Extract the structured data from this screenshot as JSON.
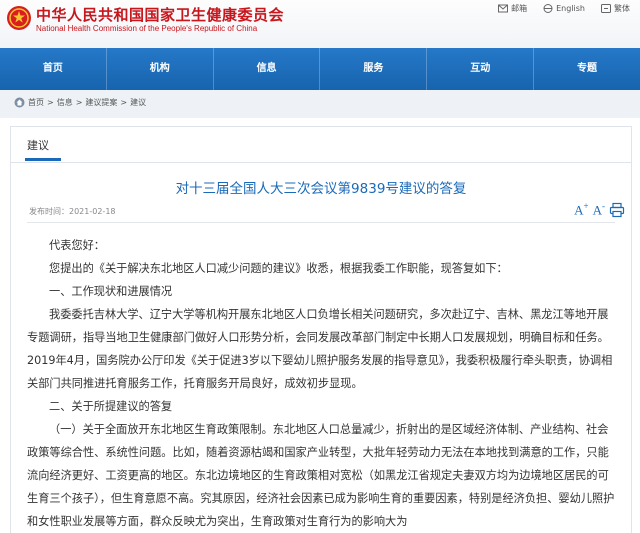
{
  "header": {
    "title_cn": "中华人民共和国国家卫生健康委员会",
    "title_en": "National Health Commission of the People's Republic of China",
    "top_links": [
      {
        "label": "邮箱",
        "icon": "mail-icon"
      },
      {
        "label": "English",
        "icon": "globe-icon"
      },
      {
        "label": "繁体",
        "icon": "chinese-icon"
      }
    ]
  },
  "nav": {
    "items": [
      "首页",
      "机构",
      "信息",
      "服务",
      "互动",
      "专题"
    ]
  },
  "breadcrumb": [
    "首页",
    "信息",
    "建议提案",
    "建议"
  ],
  "panel": {
    "section_label": "建议"
  },
  "article": {
    "title": "对十三届全国人大三次会议第9839号建议的答复",
    "publish_label": "发布时间：",
    "publish_date": "2021-02-18",
    "font_large": "A",
    "font_small": "A",
    "paragraphs": [
      "代表您好：",
      "您提出的《关于解决东北地区人口减少问题的建议》收悉，根据我委工作职能，现答复如下：",
      "一、工作现状和进展情况",
      "我委委托吉林大学、辽宁大学等机构开展东北地区人口负增长相关问题研究，多次赴辽宁、吉林、黑龙江等地开展专题调研，指导当地卫生健康部门做好人口形势分析，会同发展改革部门制定中长期人口发展规划，明确目标和任务。2019年4月，国务院办公厅印发《关于促进3岁以下婴幼儿照护服务发展的指导意见》，我委积极履行牵头职责，协调相关部门共同推进托育服务工作，托育服务开局良好，成效初步显现。",
      "二、关于所提建议的答复",
      "（一）关于全面放开东北地区生育政策限制。东北地区人口总量减少，折射出的是区域经济体制、产业结构、社会政策等综合性、系统性问题。比如，随着资源枯竭和国家产业转型，大批年轻劳动力无法在本地找到满意的工作，只能流向经济更好、工资更高的地区。东北边境地区的生育政策相对宽松（如黑龙江省规定夫妻双方均为边境地区居民的可生育三个孩子），但生育意愿不高。究其原因，经济社会因素已成为影响生育的重要因素，特别是经济负担、婴幼儿照护和女性职业发展等方面，群众反映尤为突出，生育政策对生育行为的影响大为"
    ]
  },
  "colors": {
    "brand_red": "#c8161d",
    "nav_blue": "#1763ae",
    "title_blue": "#1a6ab8"
  }
}
